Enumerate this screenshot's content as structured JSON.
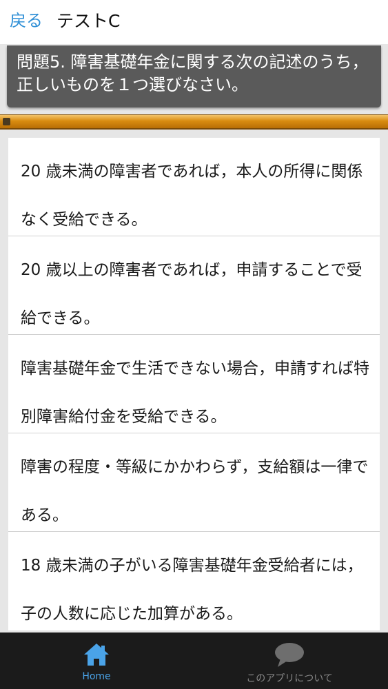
{
  "header": {
    "back_label": "戻る",
    "title": "テストC"
  },
  "question": {
    "text": "問題5. 障害基礎年金に関する次の記述のうち，正しいものを１つ選びなさい。"
  },
  "progress": {
    "fraction": 0.02
  },
  "options": [
    {
      "text": "20 歳未満の障害者であれば，本人の所得に関係なく受給できる。"
    },
    {
      "text": "20 歳以上の障害者であれば，申請することで受給できる。"
    },
    {
      "text": "障害基礎年金で生活できない場合，申請すれば特別障害給付金を受給できる。"
    },
    {
      "text": "障害の程度・等級にかかわらず，支給額は一律である。"
    },
    {
      "text": "18 歳未満の子がいる障害基礎年金受給者には，子の人数に応じた加算がある。"
    }
  ],
  "bottom_nav": {
    "home_label": "Home",
    "home_icon": "home-icon",
    "about_label": "このアプリについて",
    "about_icon": "speech-bubble-icon"
  },
  "colors": {
    "accent": "#2f8fd6",
    "progress_bar": "#d98c10",
    "question_bg": "#5a5a5a",
    "nav_bg": "#1b1b1b"
  }
}
